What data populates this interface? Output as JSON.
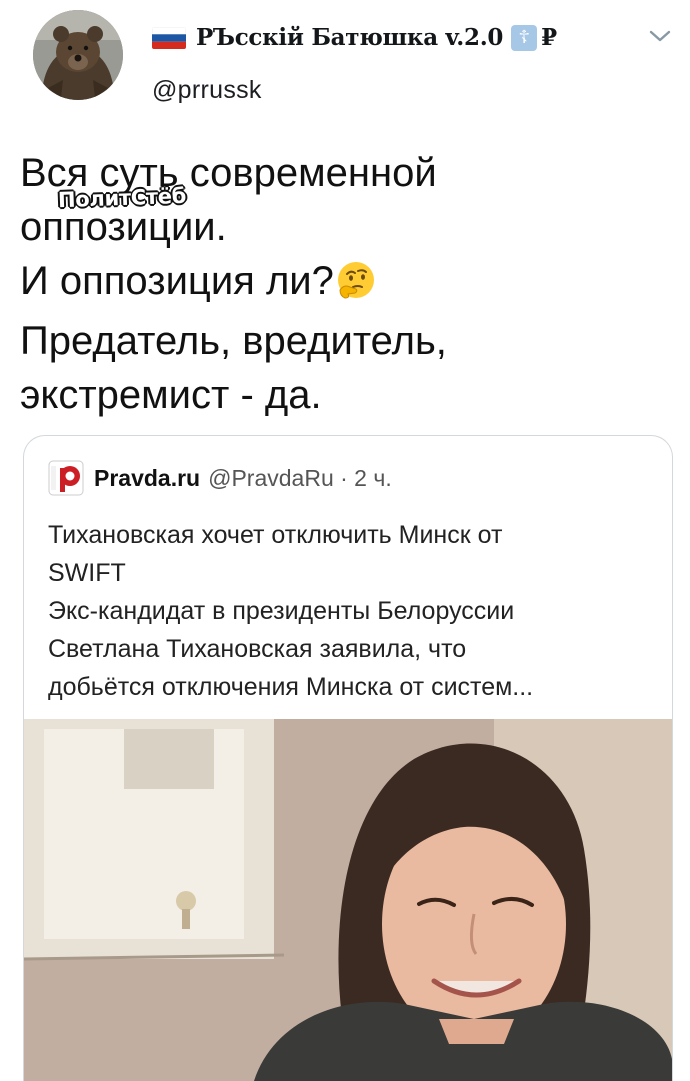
{
  "author": {
    "name": "РЪсскiй Батюшка v.2.0",
    "handle": "@prrussk",
    "flag_icon": "russian-flag-icon",
    "cross_symbol": "☦",
    "ruble_symbol": "₽"
  },
  "tweet": {
    "lines": [
      "Вся суть современной",
      "оппозиции.",
      "И оппозиция ли?",
      "Предатель, вредитель,",
      "экстремист - да."
    ],
    "emoji": "thinking-face-icon"
  },
  "watermark": "ПолитСтёб",
  "quoted": {
    "source_name": "Pravda.ru",
    "source_handle": "@PravdaRu · 2 ч.",
    "headline_lines": [
      "Тихановская хочет отключить Минск от",
      "SWIFT"
    ],
    "summary_lines": [
      "Экс-кандидат в президенты Белоруссии",
      "Светлана Тихановская заявила, что",
      "добьётся отключения Минска от систем..."
    ]
  },
  "colors": {
    "text": "#14171a",
    "border": "#d3d8dc",
    "pravda_red": "#cc1e25"
  }
}
